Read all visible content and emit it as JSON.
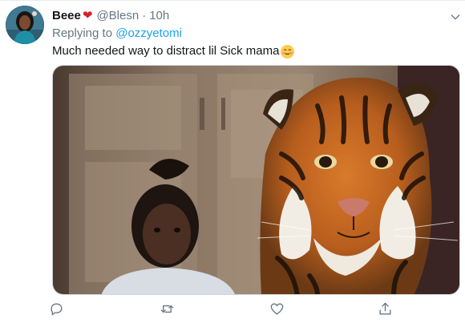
{
  "tweet": {
    "display_name": "Beee",
    "name_emoji": "❤",
    "handle": "@Blesn",
    "separator": "·",
    "time": "10h",
    "replying_prefix": "Replying to",
    "replying_handle": "@ozzyetomi",
    "text": "Much needed way to distract lil Sick mama",
    "text_emoji": "smiling-face-with-smiling-eyes"
  },
  "icons": {
    "more": "chevron-down-icon",
    "reply": "comment-icon",
    "retweet": "retweet-icon",
    "like": "heart-icon",
    "share": "share-icon"
  },
  "colors": {
    "link": "#1da1f2",
    "secondary_text": "#657786",
    "primary_text": "#14171a",
    "border": "#e6ecf0",
    "heart_emoji": "#d4202f"
  }
}
